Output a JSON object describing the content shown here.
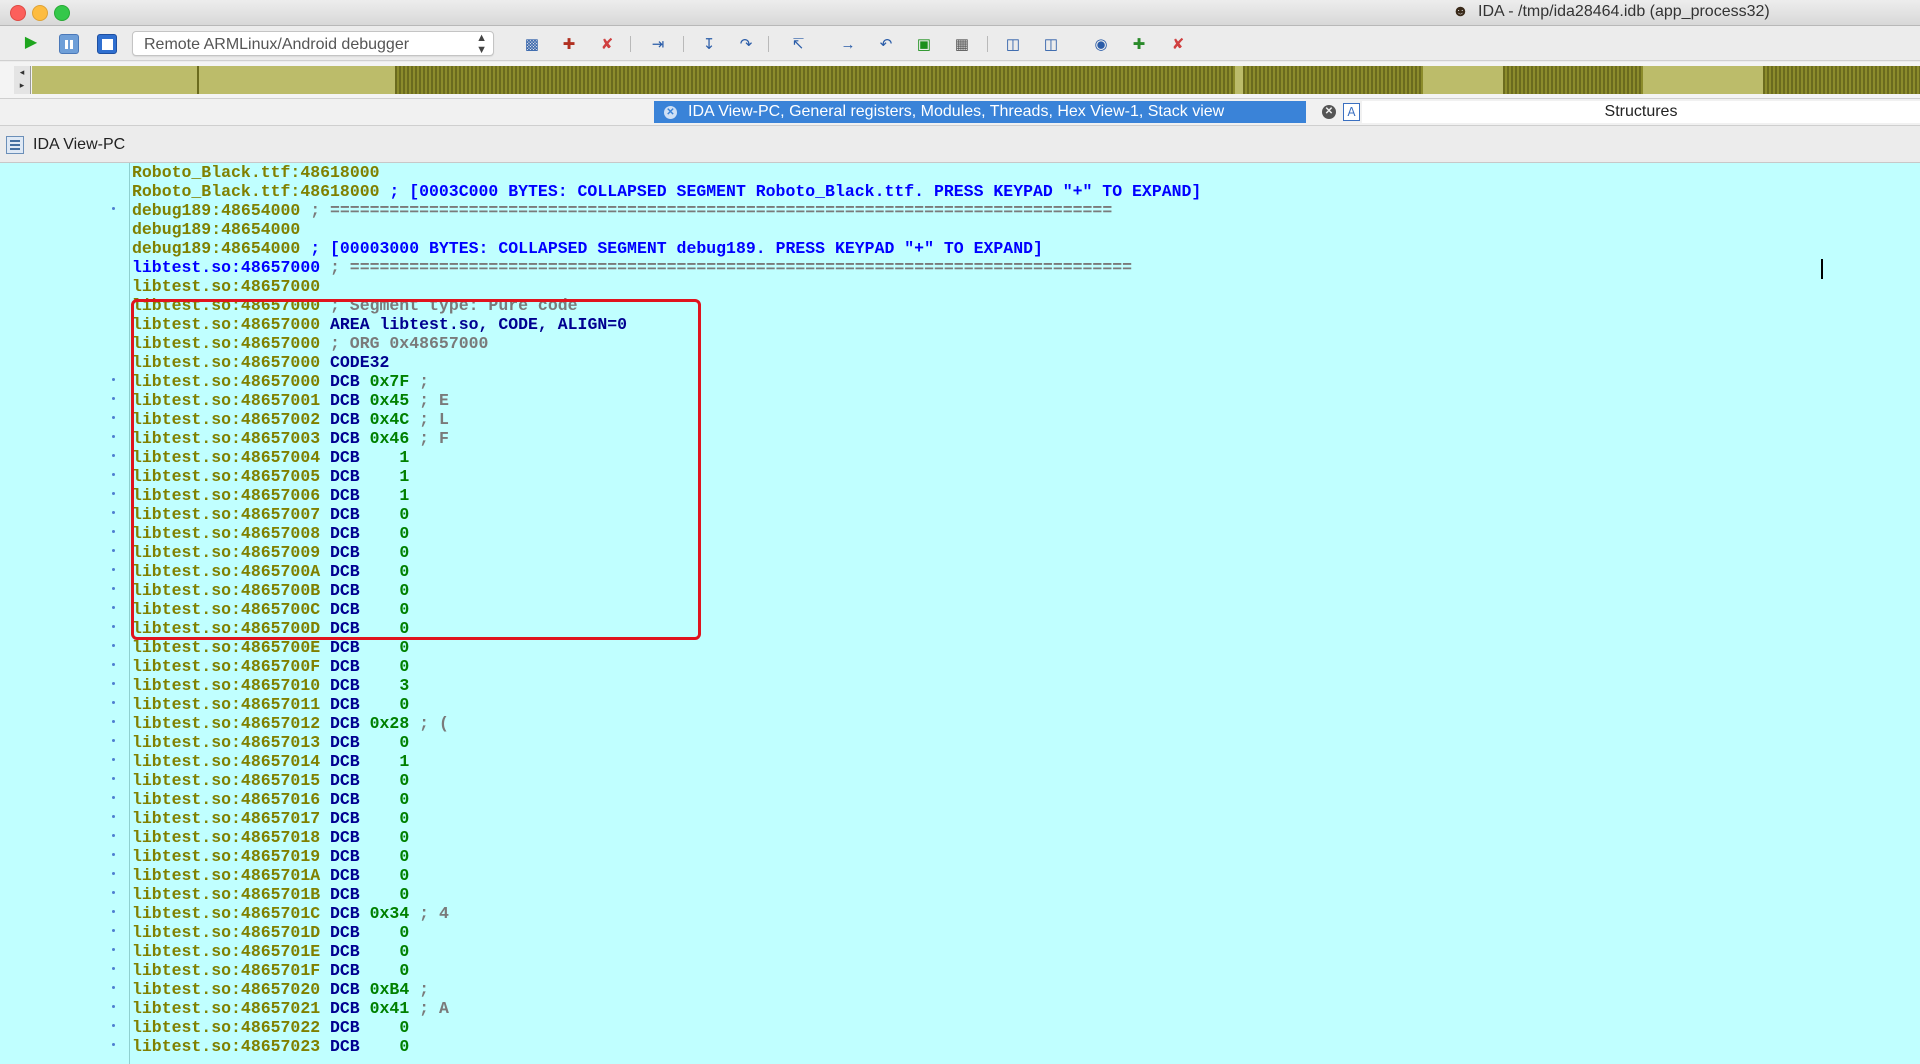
{
  "window": {
    "title": "IDA - /tmp/ida28464.idb (app_process32)"
  },
  "toolbar": {
    "debugger_select_value": "Remote ARMLinux/Android debugger",
    "icons": [
      "play-icon",
      "pause-icon",
      "stop-icon",
      "debugger-options-icon",
      "add-breakpoint-icon",
      "delete-breakpoint-icon",
      "run-to-cursor-icon",
      "step-into-icon",
      "step-over-icon",
      "step-until-return-icon",
      "jump-icon",
      "return-icon",
      "attach-icon",
      "detach-icon",
      "hex-view-icon",
      "watch-icon",
      "add-watch-icon",
      "delete-watch-icon"
    ]
  },
  "navigation_band": {
    "colors": {
      "data": "#bcbc6a",
      "code": "#6b6b1e",
      "unexplored": "#8c8c2c"
    }
  },
  "tabs": {
    "active": "IDA View-PC, General registers, Modules, Threads, Hex View-1, Stack view",
    "other": "Structures"
  },
  "view": {
    "title": "IDA View-PC"
  },
  "listing": {
    "lines": [
      {
        "addr": "Roboto_Black.ttf:48618000",
        "ins": "",
        "op": "",
        "cmt": "",
        "dot": false
      },
      {
        "addr": "Roboto_Black.ttf:48618000",
        "ins": "",
        "op": "",
        "cmt": "; [0003C000 BYTES: COLLAPSED SEGMENT Roboto_Black.ttf. PRESS KEYPAD \"+\" TO EXPAND]",
        "dot": false,
        "cmtc": "c-blue"
      },
      {
        "addr": "debug189:48654000",
        "ins": "",
        "op": "",
        "cmt": "; ===============================================================================",
        "dot": true,
        "cmtc": "c-gray"
      },
      {
        "addr": "debug189:48654000",
        "ins": "",
        "op": "",
        "cmt": "",
        "dot": false
      },
      {
        "addr": "debug189:48654000",
        "ins": "",
        "op": "",
        "cmt": "; [00003000 BYTES: COLLAPSED SEGMENT debug189. PRESS KEYPAD \"+\" TO EXPAND]",
        "dot": false,
        "cmtc": "c-blue"
      },
      {
        "addr": "libtest.so:48657000",
        "ins": "",
        "op": "",
        "cmt": "; ===============================================================================",
        "dot": false,
        "cmtc": "c-gray",
        "addrc": "c-blue"
      },
      {
        "addr": "libtest.so:48657000",
        "ins": "",
        "op": "",
        "cmt": "",
        "dot": false
      },
      {
        "addr": "libtest.so:48657000",
        "ins": "",
        "op": "",
        "cmt": "; Segment type: Pure code",
        "dot": false,
        "cmtc": "c-gray"
      },
      {
        "addr": "libtest.so:48657000",
        "ins": "AREA libtest.so, CODE, ALIGN=0",
        "op": "",
        "cmt": "",
        "dot": false
      },
      {
        "addr": "libtest.so:48657000",
        "ins": "",
        "op": "",
        "cmt": "; ORG 0x48657000",
        "dot": false,
        "cmtc": "c-gray"
      },
      {
        "addr": "libtest.so:48657000",
        "ins": "CODE32",
        "op": "",
        "cmt": "",
        "dot": false
      },
      {
        "addr": "libtest.so:48657000",
        "ins": "DCB",
        "op": "0x7F",
        "cmt": ";",
        "dot": true,
        "cmtc": "c-gray"
      },
      {
        "addr": "libtest.so:48657001",
        "ins": "DCB",
        "op": "0x45",
        "cmt": "; E",
        "dot": true,
        "cmtc": "c-gray"
      },
      {
        "addr": "libtest.so:48657002",
        "ins": "DCB",
        "op": "0x4C",
        "cmt": "; L",
        "dot": true,
        "cmtc": "c-gray"
      },
      {
        "addr": "libtest.so:48657003",
        "ins": "DCB",
        "op": "0x46",
        "cmt": "; F",
        "dot": true,
        "cmtc": "c-gray"
      },
      {
        "addr": "libtest.so:48657004",
        "ins": "DCB",
        "op": "   1",
        "cmt": "",
        "dot": true
      },
      {
        "addr": "libtest.so:48657005",
        "ins": "DCB",
        "op": "   1",
        "cmt": "",
        "dot": true
      },
      {
        "addr": "libtest.so:48657006",
        "ins": "DCB",
        "op": "   1",
        "cmt": "",
        "dot": true
      },
      {
        "addr": "libtest.so:48657007",
        "ins": "DCB",
        "op": "   0",
        "cmt": "",
        "dot": true
      },
      {
        "addr": "libtest.so:48657008",
        "ins": "DCB",
        "op": "   0",
        "cmt": "",
        "dot": true
      },
      {
        "addr": "libtest.so:48657009",
        "ins": "DCB",
        "op": "   0",
        "cmt": "",
        "dot": true
      },
      {
        "addr": "libtest.so:4865700A",
        "ins": "DCB",
        "op": "   0",
        "cmt": "",
        "dot": true
      },
      {
        "addr": "libtest.so:4865700B",
        "ins": "DCB",
        "op": "   0",
        "cmt": "",
        "dot": true
      },
      {
        "addr": "libtest.so:4865700C",
        "ins": "DCB",
        "op": "   0",
        "cmt": "",
        "dot": true
      },
      {
        "addr": "libtest.so:4865700D",
        "ins": "DCB",
        "op": "   0",
        "cmt": "",
        "dot": true
      },
      {
        "addr": "libtest.so:4865700E",
        "ins": "DCB",
        "op": "   0",
        "cmt": "",
        "dot": true
      },
      {
        "addr": "libtest.so:4865700F",
        "ins": "DCB",
        "op": "   0",
        "cmt": "",
        "dot": true
      },
      {
        "addr": "libtest.so:48657010",
        "ins": "DCB",
        "op": "   3",
        "cmt": "",
        "dot": true
      },
      {
        "addr": "libtest.so:48657011",
        "ins": "DCB",
        "op": "   0",
        "cmt": "",
        "dot": true
      },
      {
        "addr": "libtest.so:48657012",
        "ins": "DCB",
        "op": "0x28",
        "cmt": "; (",
        "dot": true,
        "cmtc": "c-gray"
      },
      {
        "addr": "libtest.so:48657013",
        "ins": "DCB",
        "op": "   0",
        "cmt": "",
        "dot": true
      },
      {
        "addr": "libtest.so:48657014",
        "ins": "DCB",
        "op": "   1",
        "cmt": "",
        "dot": true
      },
      {
        "addr": "libtest.so:48657015",
        "ins": "DCB",
        "op": "   0",
        "cmt": "",
        "dot": true
      },
      {
        "addr": "libtest.so:48657016",
        "ins": "DCB",
        "op": "   0",
        "cmt": "",
        "dot": true
      },
      {
        "addr": "libtest.so:48657017",
        "ins": "DCB",
        "op": "   0",
        "cmt": "",
        "dot": true
      },
      {
        "addr": "libtest.so:48657018",
        "ins": "DCB",
        "op": "   0",
        "cmt": "",
        "dot": true
      },
      {
        "addr": "libtest.so:48657019",
        "ins": "DCB",
        "op": "   0",
        "cmt": "",
        "dot": true
      },
      {
        "addr": "libtest.so:4865701A",
        "ins": "DCB",
        "op": "   0",
        "cmt": "",
        "dot": true
      },
      {
        "addr": "libtest.so:4865701B",
        "ins": "DCB",
        "op": "   0",
        "cmt": "",
        "dot": true
      },
      {
        "addr": "libtest.so:4865701C",
        "ins": "DCB",
        "op": "0x34",
        "cmt": "; 4",
        "dot": true,
        "cmtc": "c-gray"
      },
      {
        "addr": "libtest.so:4865701D",
        "ins": "DCB",
        "op": "   0",
        "cmt": "",
        "dot": true
      },
      {
        "addr": "libtest.so:4865701E",
        "ins": "DCB",
        "op": "   0",
        "cmt": "",
        "dot": true
      },
      {
        "addr": "libtest.so:4865701F",
        "ins": "DCB",
        "op": "   0",
        "cmt": "",
        "dot": true
      },
      {
        "addr": "libtest.so:48657020",
        "ins": "DCB",
        "op": "0xB4",
        "cmt": ";",
        "dot": true,
        "cmtc": "c-gray"
      },
      {
        "addr": "libtest.so:48657021",
        "ins": "DCB",
        "op": "0x41",
        "cmt": "; A",
        "dot": true,
        "cmtc": "c-gray"
      },
      {
        "addr": "libtest.so:48657022",
        "ins": "DCB",
        "op": "   0",
        "cmt": "",
        "dot": true
      },
      {
        "addr": "libtest.so:48657023",
        "ins": "DCB",
        "op": "   0",
        "cmt": "",
        "dot": true
      }
    ]
  }
}
